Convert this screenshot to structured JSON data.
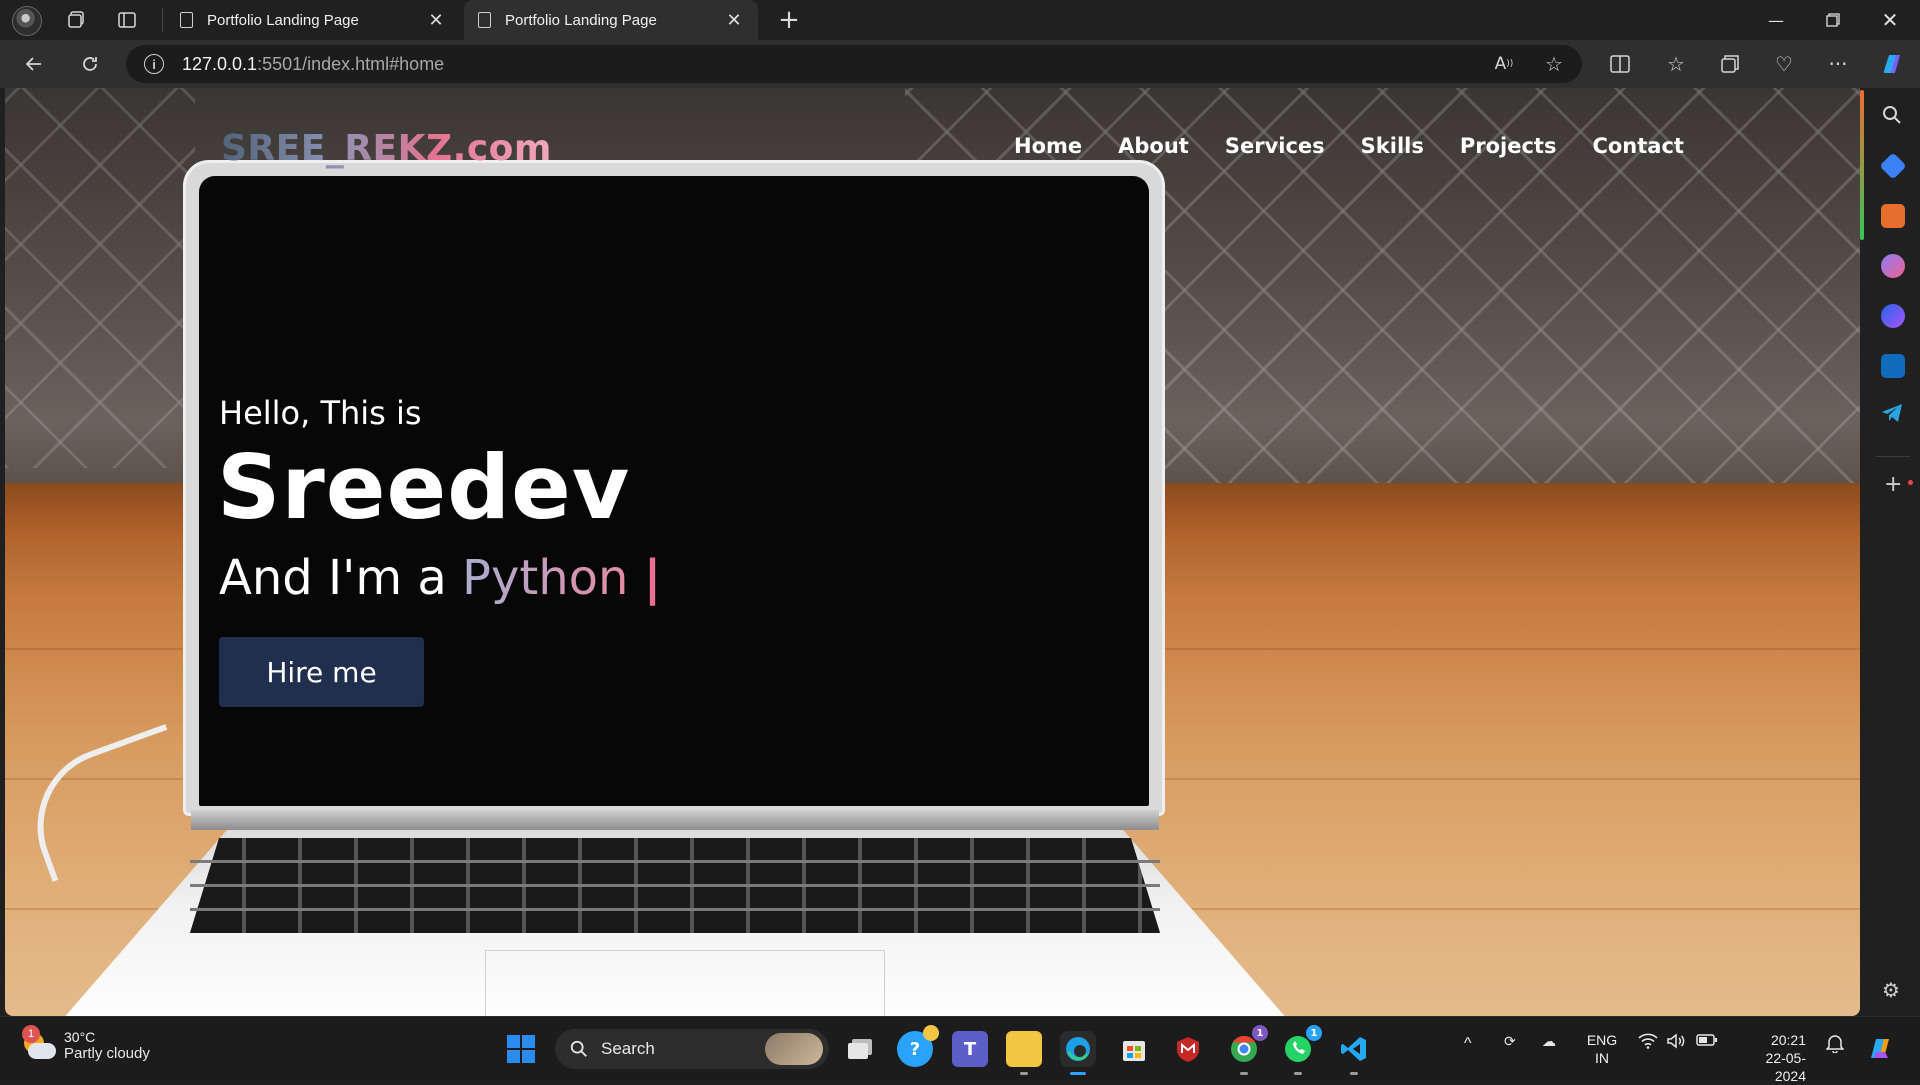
{
  "browser": {
    "tabs": [
      {
        "title": "Portfolio Landing Page",
        "active": false
      },
      {
        "title": "Portfolio Landing Page",
        "active": true
      }
    ],
    "address": {
      "host": "127.0.0.1",
      "path": ":5501/index.html#home"
    },
    "icons": {
      "back": "back-arrow-icon",
      "refresh": "refresh-icon",
      "read_aloud": "read-aloud-icon",
      "favorite": "star-icon",
      "split": "split-screen-icon",
      "favorites": "favorites-icon",
      "collections": "collections-icon",
      "health": "browser-essentials-icon",
      "more": "more-icon",
      "copilot": "copilot-icon"
    }
  },
  "page": {
    "logo": "SREE_REKZ.com",
    "nav": [
      "Home",
      "About",
      "Services",
      "Skills",
      "Projects",
      "Contact"
    ],
    "greeting": "Hello, This is",
    "name": "Sreedev",
    "role_prefix": "And I'm a ",
    "role_typed": "Python",
    "cursor": "|",
    "cta": "Hire me"
  },
  "taskbar": {
    "weather": {
      "temp": "30°C",
      "condition": "Partly cloudy",
      "badge": "1"
    },
    "search_placeholder": "Search",
    "apps": [
      {
        "name": "windows-start",
        "color": "#2b8cf0"
      },
      {
        "name": "task-view",
        "color": "#d8d8d8"
      },
      {
        "name": "help",
        "color": "#2aa3ff"
      },
      {
        "name": "teams",
        "color": "#5b5fc7"
      },
      {
        "name": "file-explorer",
        "color": "#f4c542"
      },
      {
        "name": "edge",
        "color": "#1ea0e6"
      },
      {
        "name": "microsoft-store",
        "color": "#d8d8d8"
      },
      {
        "name": "mcafee",
        "color": "#c62828"
      },
      {
        "name": "chrome",
        "color": "#34a853"
      },
      {
        "name": "whatsapp",
        "color": "#25d366"
      },
      {
        "name": "vscode",
        "color": "#23a9f2"
      }
    ],
    "chrome_badge": "1",
    "whatsapp_badge": "1",
    "lang": {
      "line1": "ENG",
      "line2": "IN"
    },
    "time": "20:21",
    "date": "22-05-2024"
  }
}
